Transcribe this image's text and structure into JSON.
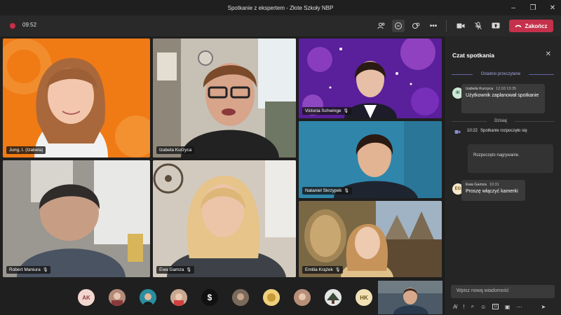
{
  "window": {
    "title": "Spotkanie z ekspertem - Złote Szkoły NBP",
    "controls": [
      "–",
      "❐",
      "✕"
    ]
  },
  "toolbar": {
    "timer": "09:52",
    "leave_label": "Zakończ",
    "accent_color": "#c4314b"
  },
  "participants": [
    {
      "name": "Jung, I. (Izabela)",
      "mic": false
    },
    {
      "name": "Izabela Kurzyca",
      "mic": false
    },
    {
      "name": "Victoria Schwinge",
      "mic": true
    },
    {
      "name": "Nataniel Skrzypek",
      "mic": true
    },
    {
      "name": "Robert Maniura",
      "mic": true
    },
    {
      "name": "Ewa Gamza",
      "mic": true
    },
    {
      "name": "Emilia Krążek",
      "mic": true
    }
  ],
  "roster": {
    "avatars": [
      "AK",
      "",
      "",
      "",
      "$",
      "",
      "",
      "",
      "",
      "HK"
    ]
  },
  "chat": {
    "title": "Czat spotkania",
    "last_read_label": "Ostatnio przeczytane",
    "today_label": "Dzisiaj",
    "messages": [
      {
        "initials": "IK",
        "author": "Izabela Kurzyca",
        "time": "12.03 13:35",
        "text": "Użytkownik zaplanował spotkanie"
      },
      {
        "time": "10:22",
        "text": "Spotkanie rozpoczęło się"
      },
      {
        "text": "Rozpoczęto nagrywanie."
      },
      {
        "initials": "EG",
        "author": "Ewa Gamza",
        "time": "10:31",
        "text": "Proszę włączyć kamerki"
      }
    ],
    "compose_placeholder": "Wpisz nową wiadomość"
  }
}
